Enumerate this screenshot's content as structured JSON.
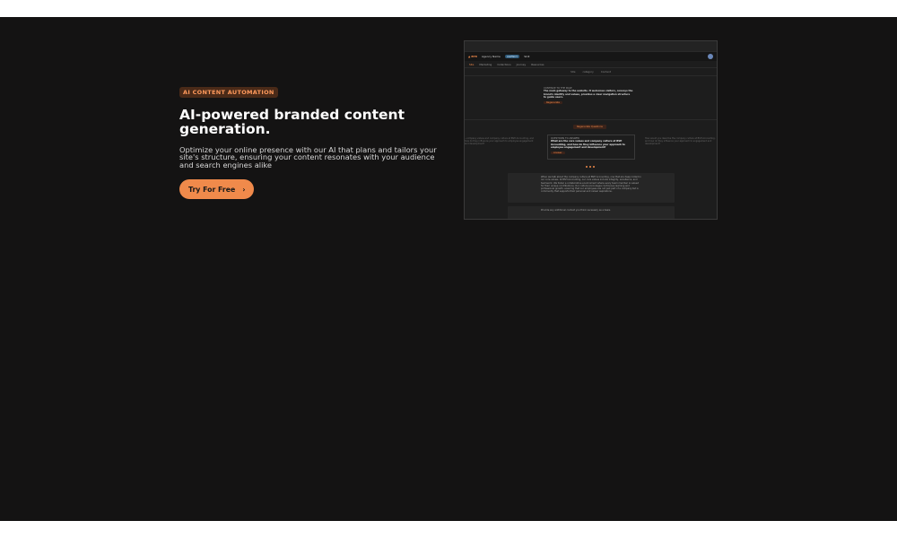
{
  "hero": {
    "badge": "AI CONTENT AUTOMATION",
    "title": "AI-powered branded content generation.",
    "description": "Optimize your online presence with our AI that plans and tailors your site's structure, ensuring your content resonates with your audience and search engines alike",
    "cta_label": "Try For Free",
    "cta_icon": "chevron-right-icon"
  },
  "preview": {
    "app_logo": "▲ BYR",
    "workspace": "Agency Name",
    "workspace_tag": "AGENCY",
    "page": "Skill",
    "tabs": [
      "Site",
      "Marketing",
      "Collections",
      "Journey",
      "Resources"
    ],
    "sub_tabs": [
      "Site",
      "category",
      "Content"
    ],
    "top_card_heading": "CONTINUE TO THE PAGE",
    "top_card_text": "The main gateway to the website. It welcomes visitors, conveys the brand's identity and values, provides a clear navigation structure to guide users.",
    "top_card_button": "Regenerate",
    "center_button": "Regenerate Questions",
    "center_card_heading": "QUESTIONS TO ANSWER",
    "center_card_text": "What are the core values and company culture at BSH Accounting, and how do they influence your approach to employee engagement and development?",
    "center_card_button": "Answer",
    "left_card_text": "...company values and company culture at BSH Accounting, and how do they influence your approach to employee engagement and development?",
    "right_card_text": "How would you describe the company culture at BSH Accounting, and how do they influence your approach to engagement and development?",
    "answer_panel_text": "When we talk about the company culture at BSH Accounting, one that are deep rooted in our core values. At BSH Accounting, our core values include integrity, excellence, and teamwork. We foster a collaborative environment where every team member is valued for their unique contributions. Our culture encourages continuous learning and professional growth, ensuring that our employees are not just part of a company but a community that supports their personal and career aspirations.",
    "followup_text": "Provide any additional context you think necessary as a basis."
  },
  "colors": {
    "accent": "#f08a4b",
    "background": "#141313"
  }
}
